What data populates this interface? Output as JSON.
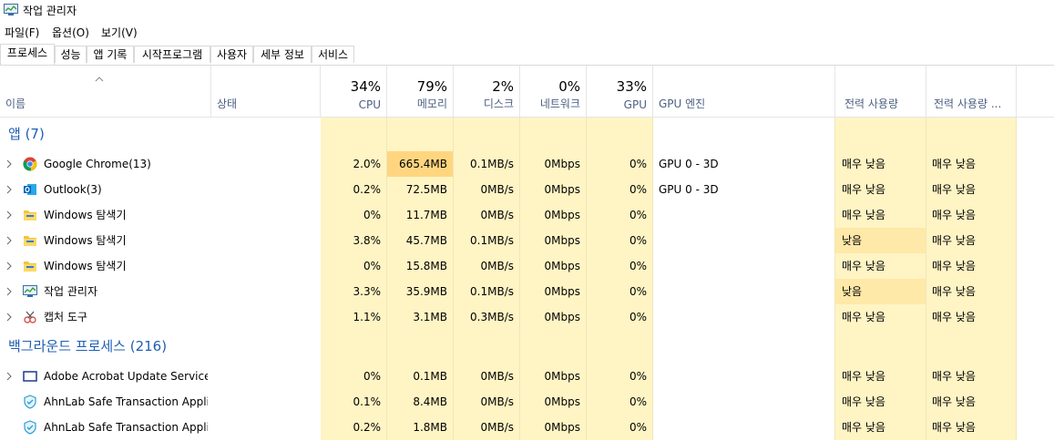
{
  "window": {
    "title": "작업 관리자",
    "icon": "task-manager-icon"
  },
  "menu": [
    "파일(F)",
    "옵션(O)",
    "보기(V)"
  ],
  "tabs": [
    {
      "label": "프로세스",
      "active": true
    },
    {
      "label": "성능",
      "active": false
    },
    {
      "label": "앱 기록",
      "active": false
    },
    {
      "label": "시작프로그램",
      "active": false
    },
    {
      "label": "사용자",
      "active": false
    },
    {
      "label": "세부 정보",
      "active": false
    },
    {
      "label": "서비스",
      "active": false
    }
  ],
  "columns": {
    "name": "이름",
    "status": "상태",
    "cpu": {
      "pct": "34%",
      "label": "CPU"
    },
    "memory": {
      "pct": "79%",
      "label": "메모리"
    },
    "disk": {
      "pct": "2%",
      "label": "디스크"
    },
    "network": {
      "pct": "0%",
      "label": "네트워크"
    },
    "gpu": {
      "pct": "33%",
      "label": "GPU"
    },
    "gpu_engine": "GPU 엔진",
    "power": "전력 사용량",
    "power_trend": "전력 사용량 ..."
  },
  "groups": {
    "apps": "앱 (7)",
    "background": "백그라운드 프로세스 (216)"
  },
  "app_rows": [
    {
      "name": "Google Chrome(13)",
      "icon": "chrome-icon",
      "cpu": "2.0%",
      "mem": "665.4MB",
      "disk": "0.1MB/s",
      "net": "0Mbps",
      "gpu": "0%",
      "engine": "GPU 0 - 3D",
      "power": "매우 낮음",
      "trend": "매우 낮음"
    },
    {
      "name": "Outlook(3)",
      "icon": "outlook-icon",
      "cpu": "0.2%",
      "mem": "72.5MB",
      "disk": "0MB/s",
      "net": "0Mbps",
      "gpu": "0%",
      "engine": "GPU 0 - 3D",
      "power": "매우 낮음",
      "trend": "매우 낮음"
    },
    {
      "name": "Windows 탐색기",
      "icon": "folder-icon",
      "cpu": "0%",
      "mem": "11.7MB",
      "disk": "0MB/s",
      "net": "0Mbps",
      "gpu": "0%",
      "engine": "",
      "power": "매우 낮음",
      "trend": "매우 낮음"
    },
    {
      "name": "Windows 탐색기",
      "icon": "folder-icon",
      "cpu": "3.8%",
      "mem": "45.7MB",
      "disk": "0.1MB/s",
      "net": "0Mbps",
      "gpu": "0%",
      "engine": "",
      "power": "낮음",
      "trend": "매우 낮음"
    },
    {
      "name": "Windows 탐색기",
      "icon": "folder-icon",
      "cpu": "0%",
      "mem": "15.8MB",
      "disk": "0MB/s",
      "net": "0Mbps",
      "gpu": "0%",
      "engine": "",
      "power": "매우 낮음",
      "trend": "매우 낮음"
    },
    {
      "name": "작업 관리자",
      "icon": "task-manager-icon",
      "cpu": "3.3%",
      "mem": "35.9MB",
      "disk": "0.1MB/s",
      "net": "0Mbps",
      "gpu": "0%",
      "engine": "",
      "power": "낮음",
      "trend": "매우 낮음"
    },
    {
      "name": "캡처 도구",
      "icon": "snipping-tool-icon",
      "cpu": "1.1%",
      "mem": "3.1MB",
      "disk": "0.3MB/s",
      "net": "0Mbps",
      "gpu": "0%",
      "engine": "",
      "power": "매우 낮음",
      "trend": "매우 낮음"
    }
  ],
  "bg_rows": [
    {
      "name": "Adobe Acrobat Update Service(...",
      "icon": "service-window-icon",
      "expander": true,
      "cpu": "0%",
      "mem": "0.1MB",
      "disk": "0MB/s",
      "net": "0Mbps",
      "gpu": "0%",
      "engine": "",
      "power": "매우 낮음",
      "trend": "매우 낮음"
    },
    {
      "name": "AhnLab Safe Transaction Appli...",
      "icon": "ahnlab-shield-icon",
      "expander": false,
      "cpu": "0.1%",
      "mem": "8.4MB",
      "disk": "0MB/s",
      "net": "0Mbps",
      "gpu": "0%",
      "engine": "",
      "power": "매우 낮음",
      "trend": "매우 낮음"
    },
    {
      "name": "AhnLab Safe Transaction Appli...",
      "icon": "ahnlab-shield-icon",
      "expander": false,
      "cpu": "0.2%",
      "mem": "1.8MB",
      "disk": "0MB/s",
      "net": "0Mbps",
      "gpu": "0%",
      "engine": "",
      "power": "매우 낮음",
      "trend": "매우 낮음"
    }
  ],
  "colors": {
    "heat_light": "#fff4c4",
    "heat_medium": "#ffe9a8",
    "heat_strong": "#ffd67f",
    "group_text": "#1f5fb3",
    "header_label": "#4d6082"
  }
}
